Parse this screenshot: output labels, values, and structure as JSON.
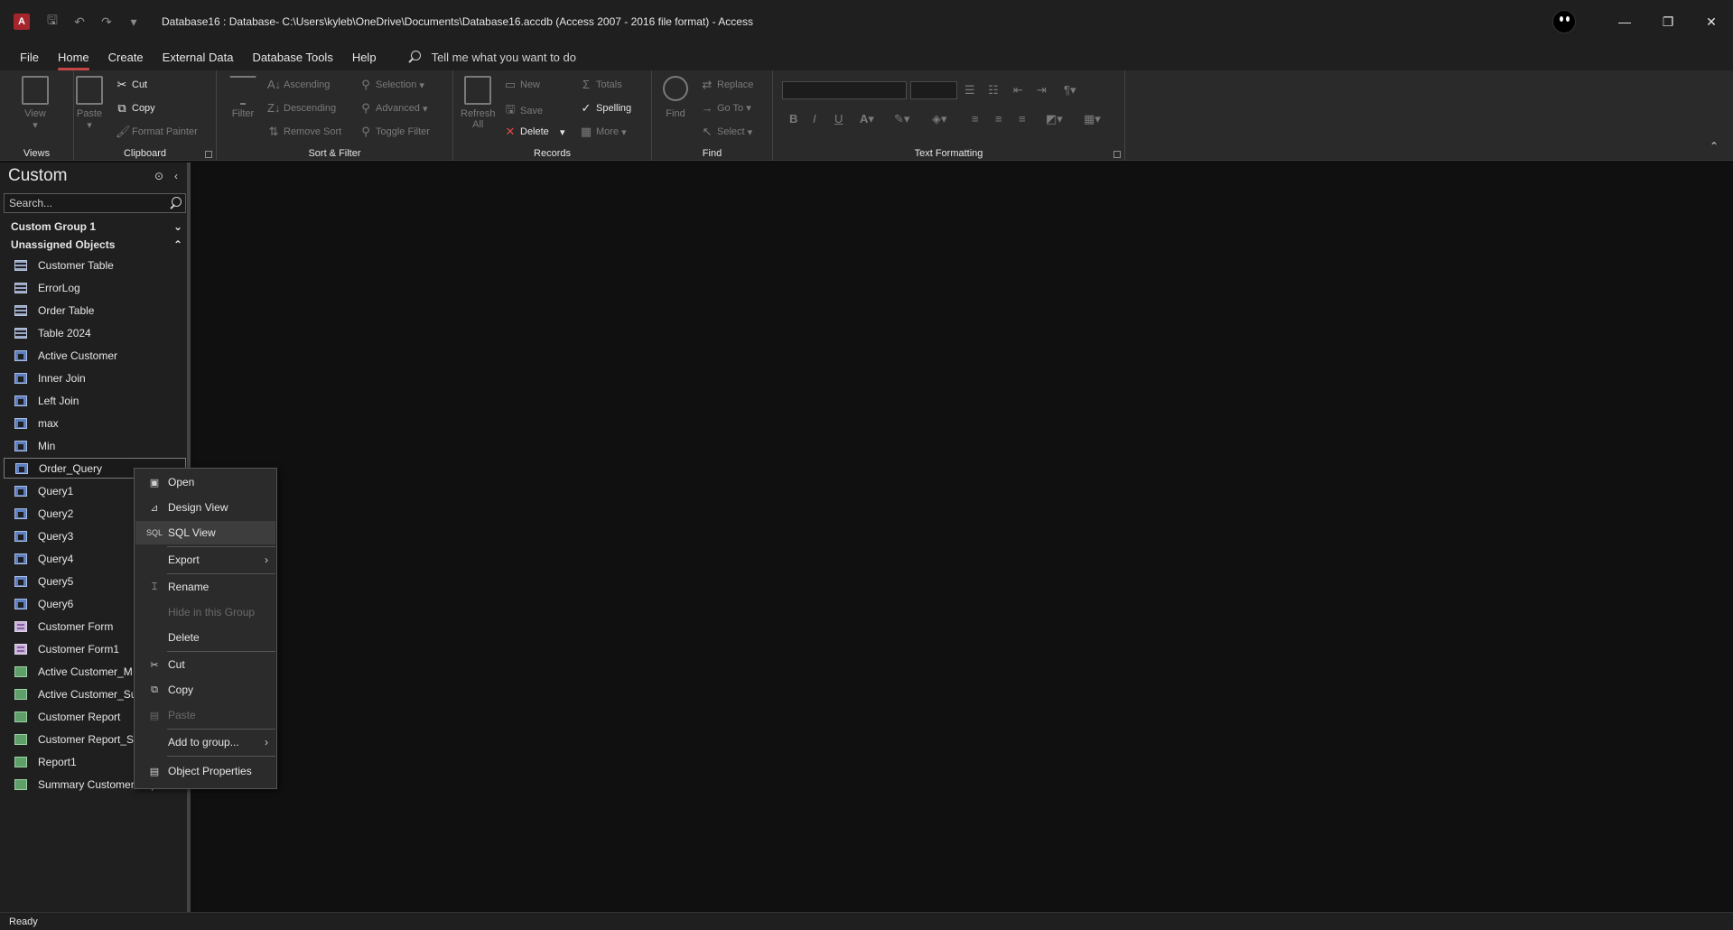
{
  "titlebar": {
    "title": "Database16 : Database- C:\\Users\\kyleb\\OneDrive\\Documents\\Database16.accdb (Access 2007 - 2016 file format)  -  Access"
  },
  "tabs": [
    "File",
    "Home",
    "Create",
    "External Data",
    "Database Tools",
    "Help"
  ],
  "active_tab": "Home",
  "tellme": "Tell me what you want to do",
  "ribbon": {
    "views": {
      "label": "Views",
      "view": "View"
    },
    "clipboard": {
      "label": "Clipboard",
      "paste": "Paste",
      "cut": "Cut",
      "copy": "Copy",
      "format_painter": "Format Painter"
    },
    "sortfilter": {
      "label": "Sort & Filter",
      "filter": "Filter",
      "ascending": "Ascending",
      "descending": "Descending",
      "remove_sort": "Remove Sort",
      "selection": "Selection",
      "advanced": "Advanced",
      "toggle_filter": "Toggle Filter"
    },
    "records": {
      "label": "Records",
      "refresh": "Refresh",
      "refresh_sub": "All",
      "new": "New",
      "save": "Save",
      "delete": "Delete",
      "totals": "Totals",
      "spelling": "Spelling",
      "more": "More"
    },
    "find": {
      "label": "Find",
      "find": "Find",
      "replace": "Replace",
      "goto": "Go To",
      "select": "Select"
    },
    "text_formatting": {
      "label": "Text Formatting"
    }
  },
  "nav": {
    "title": "Custom",
    "search_placeholder": "Search...",
    "groups": [
      "Custom Group 1",
      "Unassigned Objects"
    ],
    "items": [
      {
        "label": "Customer Table",
        "type": "table"
      },
      {
        "label": "ErrorLog",
        "type": "table"
      },
      {
        "label": "Order Table",
        "type": "table"
      },
      {
        "label": "Table 2024",
        "type": "table"
      },
      {
        "label": "Active Customer",
        "type": "query"
      },
      {
        "label": "Inner Join",
        "type": "query"
      },
      {
        "label": "Left Join",
        "type": "query"
      },
      {
        "label": "max",
        "type": "query"
      },
      {
        "label": "Min",
        "type": "query"
      },
      {
        "label": "Order_Query",
        "type": "query"
      },
      {
        "label": "Query1",
        "type": "query"
      },
      {
        "label": "Query2",
        "type": "query"
      },
      {
        "label": "Query3",
        "type": "query"
      },
      {
        "label": "Query4",
        "type": "query"
      },
      {
        "label": "Query5",
        "type": "query"
      },
      {
        "label": "Query6",
        "type": "query"
      },
      {
        "label": "Customer Form",
        "type": "form"
      },
      {
        "label": "Customer Form1",
        "type": "form"
      },
      {
        "label": "Active Customer_M",
        "type": "report"
      },
      {
        "label": "Active Customer_Su",
        "type": "report"
      },
      {
        "label": "Customer Report",
        "type": "report"
      },
      {
        "label": "Customer Report_Su",
        "type": "report"
      },
      {
        "label": "Report1",
        "type": "report"
      },
      {
        "label": "Summary Customer Report",
        "type": "report"
      }
    ]
  },
  "context_menu": {
    "open": "Open",
    "design_view": "Design View",
    "sql_view": "SQL View",
    "export": "Export",
    "rename": "Rename",
    "hide": "Hide in this Group",
    "delete": "Delete",
    "cut": "Cut",
    "copy": "Copy",
    "paste": "Paste",
    "add_to_group": "Add to group...",
    "object_properties": "Object Properties",
    "sql_icon": "SQL"
  },
  "status": "Ready"
}
